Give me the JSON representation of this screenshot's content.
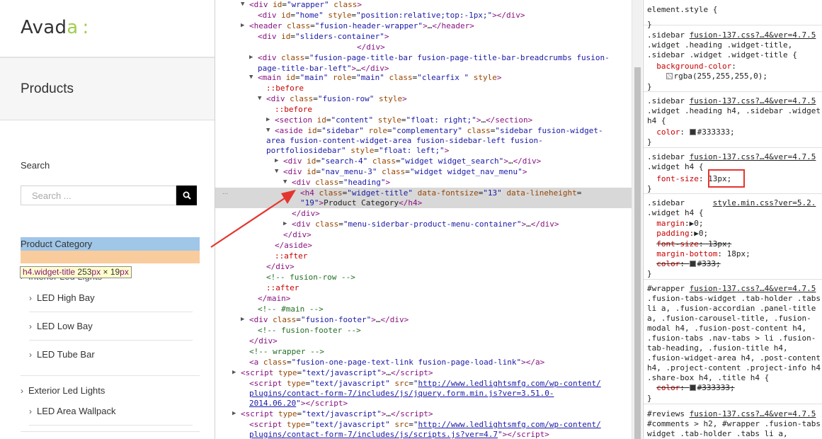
{
  "site": {
    "logo_main": "Avad",
    "logo_accent": "a",
    "logo_mark": ":",
    "page_title": "Products",
    "search_title": "Search",
    "search_placeholder": "Search ...",
    "product_category_title": "Product Category",
    "tooltip": {
      "selector": "h4.widget-title",
      "width": "253",
      "height": "19",
      "unit": "px",
      "times": "×"
    },
    "menu": {
      "cat1": "Interior Led Lights",
      "cat1_items": [
        "LED High Bay",
        "LED Low Bay",
        "LED Tube Bar"
      ],
      "cat2": "Exterior Led Lights",
      "cat2_items": [
        "LED Area Wallpack"
      ]
    }
  },
  "elements": {
    "lines": [
      {
        "h": "<span class='t'>&lt;div</span> <span class='a'>id</span>=<span class='v'>\"wrapper\"</span> <span class='a'>class</span><span class='t'>&gt;</span>"
      },
      {
        "h": "<span class='t'>&lt;div</span> <span class='a'>id</span>=<span class='v'>\"home\"</span> <span class='a'>style</span>=<span class='v'>\"position:relative;top:-1px;\"</span><span class='t'>&gt;&lt;/div&gt;</span>"
      },
      {
        "h": "<span class='t'>&lt;header</span> <span class='a'>class</span>=<span class='v'>\"fusion-header-wrapper\"</span><span class='t'>&gt;</span>…<span class='t'>&lt;/header&gt;</span>"
      },
      {
        "h": "<span class='t'>&lt;div</span> <span class='a'>id</span>=<span class='v'>\"sliders-container\"</span><span class='t'>&gt;</span>"
      },
      {
        "h": "<span class='t'>&lt;/div&gt;</span>"
      },
      {
        "h": "<span class='t'>&lt;div</span> <span class='a'>class</span>=<span class='v'>\"fusion-page-title-bar fusion-page-title-bar-breadcrumbs fusion-</span>"
      },
      {
        "h": "<span class='v'>page-title-bar-left\"</span><span class='t'>&gt;</span>…<span class='t'>&lt;/div&gt;</span>"
      },
      {
        "h": "<span class='t'>&lt;main</span> <span class='a'>id</span>=<span class='v'>\"main\"</span> <span class='a'>role</span>=<span class='v'>\"main\"</span> <span class='a'>class</span>=<span class='v'>\"clearfix \"</span> <span class='a'>style</span><span class='t'>&gt;</span>"
      },
      {
        "h": "<span class='p'>::before</span>"
      },
      {
        "h": "<span class='t'>&lt;div</span> <span class='a'>class</span>=<span class='v'>\"fusion-row\"</span> <span class='a'>style</span><span class='t'>&gt;</span>"
      },
      {
        "h": "<span class='p'>::before</span>"
      },
      {
        "h": "<span class='t'>&lt;section</span> <span class='a'>id</span>=<span class='v'>\"content\"</span> <span class='a'>style</span>=<span class='v'>\"float: right;\"</span><span class='t'>&gt;</span>…<span class='t'>&lt;/section&gt;</span>"
      },
      {
        "h": "<span class='t'>&lt;aside</span> <span class='a'>id</span>=<span class='v'>\"sidebar\"</span> <span class='a'>role</span>=<span class='v'>\"complementary\"</span> <span class='a'>class</span>=<span class='v'>\"sidebar fusion-widget-</span>"
      },
      {
        "h": "<span class='v'>area fusion-content-widget-area fusion-sidebar-left fusion-</span>"
      },
      {
        "h": "<span class='v'>portfoliosidebar\"</span> <span class='a'>style</span>=<span class='v'>\"float: left;\"</span><span class='t'>&gt;</span>"
      },
      {
        "h": "<span class='t'>&lt;div</span> <span class='a'>id</span>=<span class='v'>\"search-4\"</span> <span class='a'>class</span>=<span class='v'>\"widget widget_search\"</span><span class='t'>&gt;</span>…<span class='t'>&lt;/div&gt;</span>"
      },
      {
        "h": "<span class='t'>&lt;div</span> <span class='a'>id</span>=<span class='v'>\"nav_menu-3\"</span> <span class='a'>class</span>=<span class='v'>\"widget widget_nav_menu\"</span><span class='t'>&gt;</span>"
      },
      {
        "h": "<span class='t'>&lt;div</span> <span class='a'>class</span>=<span class='v'>\"heading\"</span><span class='t'>&gt;</span>"
      },
      {
        "h": "<span class='t'>&lt;h4</span> <span class='a'>class</span>=<span class='v'>\"widget-title\"</span> <span class='a'>data-fontsize</span>=<span class='v'>\"13\"</span> <span class='a'>data-lineheight</span>="
      },
      {
        "h": "<span class='v'>\"19\"</span><span class='t'>&gt;</span>Product Category<span class='t'>&lt;/h4&gt;</span>"
      },
      {
        "h": "<span class='t'>&lt;/div&gt;</span>"
      },
      {
        "h": "<span class='t'>&lt;div</span> <span class='a'>class</span>=<span class='v'>\"menu-siderbar-product-menu-container\"</span><span class='t'>&gt;</span>…<span class='t'>&lt;/div&gt;</span>"
      },
      {
        "h": "<span class='t'>&lt;/div&gt;</span>"
      },
      {
        "h": "<span class='t'>&lt;/aside&gt;</span>"
      },
      {
        "h": "<span class='p'>::after</span>"
      },
      {
        "h": "<span class='t'>&lt;/div&gt;</span>"
      },
      {
        "h": "<span class='c'>&lt;!-- fusion-row --&gt;</span>"
      },
      {
        "h": "<span class='p'>::after</span>"
      },
      {
        "h": "<span class='t'>&lt;/main&gt;</span>"
      },
      {
        "h": "<span class='c'>&lt;!-- #main --&gt;</span>"
      },
      {
        "h": "<span class='t'>&lt;div</span> <span class='a'>class</span>=<span class='v'>\"fusion-footer\"</span><span class='t'>&gt;</span>…<span class='t'>&lt;/div&gt;</span>"
      },
      {
        "h": "<span class='c'>&lt;!-- fusion-footer --&gt;</span>"
      },
      {
        "h": "<span class='t'>&lt;/div&gt;</span>"
      },
      {
        "h": "<span class='c'>&lt;!-- wrapper --&gt;</span>"
      },
      {
        "h": "<span class='t'>&lt;a</span> <span class='a'>class</span>=<span class='v'>\"fusion-one-page-text-link fusion-page-load-link\"</span><span class='t'>&gt;&lt;/a&gt;</span>"
      },
      {
        "h": "<span class='t'>&lt;script</span> <span class='a'>type</span>=<span class='v'>\"text/javascript\"</span><span class='t'>&gt;</span>…<span class='t'>&lt;/script&gt;</span>"
      },
      {
        "h": "<span class='t'>&lt;script</span> <span class='a'>type</span>=<span class='v'>\"text/javascript\"</span> <span class='a'>src</span>=<span class='v'>\"</span><span class='u' style='color:#1a1aa6'>http://www.ledlightsmfg.com/wp-content/</span>"
      },
      {
        "h": "<span class='u' style='color:#1a1aa6'>plugins/contact-form-7/includes/js/jquery.form.min.js?ver=3.51.0-</span>"
      },
      {
        "h": "<span class='u' style='color:#1a1aa6'>2014.06.20</span><span class='v'>\"</span><span class='t'>&gt;&lt;/script&gt;</span>"
      },
      {
        "h": "<span class='t'>&lt;script</span> <span class='a'>type</span>=<span class='v'>\"text/javascript\"</span><span class='t'>&gt;</span>…<span class='t'>&lt;/script&gt;</span>"
      },
      {
        "h": "<span class='t'>&lt;script</span> <span class='a'>type</span>=<span class='v'>\"text/javascript\"</span> <span class='a'>src</span>=<span class='v'>\"</span><span class='u' style='color:#1a1aa6'>http://www.ledlightsmfg.com/wp-content/</span>"
      },
      {
        "h": "<span class='u' style='color:#1a1aa6'>plugins/contact-form-7/includes/js/scripts.js?ver=4.7</span><span class='v'>\"</span><span class='t'>&gt;&lt;/script&gt;</span>"
      }
    ],
    "ellipsis": "..."
  },
  "styles": {
    "lines": [
      {
        "h": "element.style {"
      },
      {
        "h": "}"
      },
      {
        "h": ".sidebar <span class='u'>fusion-137.css?…4&amp;ver=4.7.5</span>"
      },
      {
        "h": ".widget .heading .widget-title,"
      },
      {
        "h": ".sidebar .widget .widget-title {"
      },
      {
        "h": "&nbsp;&nbsp;<span class='p'>background-color</span>:"
      },
      {
        "h": "&nbsp;&nbsp;&nbsp;&nbsp;<span class='sw chk'></span>rgba(255,255,255,0);"
      },
      {
        "h": "}"
      },
      {
        "h": ".sidebar <span class='u'>fusion-137.css?…4&amp;ver=4.7.5</span>"
      },
      {
        "h": ".widget .heading h4, .sidebar .widget"
      },
      {
        "h": "h4 {"
      },
      {
        "h": "&nbsp;&nbsp;<span class='p'>color</span>: <span class='sw'></span>#333333;"
      },
      {
        "h": "}"
      },
      {
        "h": ".sidebar <span class='u'>fusion-137.css?…4&amp;ver=4.7.5</span>"
      },
      {
        "h": ".widget h4 {"
      },
      {
        "h": "&nbsp;&nbsp;<span class='p'>font-size</span>: 13px;"
      },
      {
        "h": "}"
      },
      {
        "h": ".sidebar&nbsp;&nbsp;&nbsp;&nbsp;&nbsp;&nbsp;<span class='u'>style.min.css?ver=5.2.</span>"
      },
      {
        "h": ".widget h4 {"
      },
      {
        "h": "&nbsp;&nbsp;<span class='p'>margin</span>:▶0;"
      },
      {
        "h": "&nbsp;&nbsp;<span class='p'>padding</span>:▶0;"
      },
      {
        "h": "&nbsp;&nbsp;<s><span class='p'>font-size</span>: 13px;</s>"
      },
      {
        "h": "&nbsp;&nbsp;<span class='p'>margin-bottom</span>: 18px;"
      },
      {
        "h": "&nbsp;&nbsp;<s><span class='p'>color</span>: <span class='sw'></span>#333;</s>"
      },
      {
        "h": "}"
      },
      {
        "h": "#wrapper <span class='u'>fusion-137.css?…4&amp;ver=4.7.5</span>"
      },
      {
        "h": ".fusion-tabs-widget .tab-holder .tabs"
      },
      {
        "h": "li a, .fusion-accordian .panel-title"
      },
      {
        "h": "a, .fusion-carousel-title, .fusion-"
      },
      {
        "h": "modal h4, .fusion-post-content h4,"
      },
      {
        "h": ".fusion-tabs .nav-tabs &gt; li .fusion-"
      },
      {
        "h": "tab-heading, .fusion-title h4,"
      },
      {
        "h": ".fusion-widget-area h4, .post-content"
      },
      {
        "h": "h4, .project-content .project-info h4"
      },
      {
        "h": ".share-box h4, .title h4 {"
      },
      {
        "h": "&nbsp;&nbsp;<s><span class='p'>color</span>: <span class='sw'></span>#333333;</s>"
      },
      {
        "h": "}"
      },
      {
        "h": "#reviews <span class='u'>fusion-137.css?…4&amp;ver=4.7.5</span>"
      },
      {
        "h": "#comments &gt; h2, #wrapper .fusion-tabs"
      },
      {
        "h": "widget .tab-holder .tabs li a,"
      }
    ]
  },
  "colors": {
    "accent": "#a0ce4e",
    "highlight_content": "#6fa8dc",
    "highlight_margin": "#f6b26b",
    "annotation_red": "#e3362f"
  }
}
